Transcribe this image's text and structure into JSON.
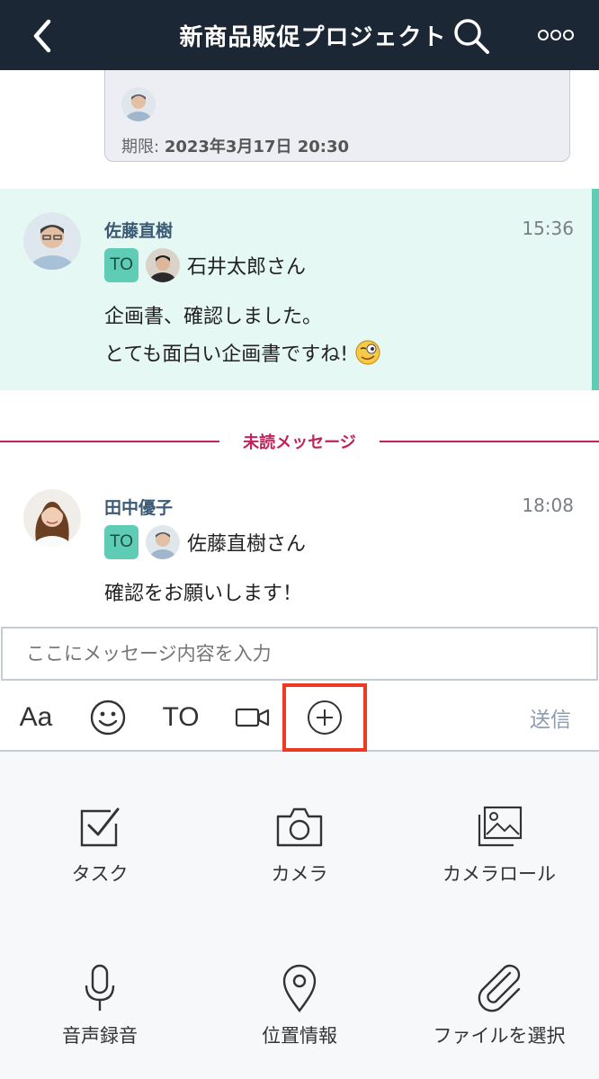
{
  "header": {
    "title": "新商品販促プロジェクト",
    "back_icon": "chevron-left-icon",
    "search_icon": "search-icon",
    "more_icon": "more-dots-icon"
  },
  "task_card": {
    "deadline_label": "期限:",
    "deadline_value": "2023年3月17日 20:30"
  },
  "messages": [
    {
      "sender": "佐藤直樹",
      "time": "15:36",
      "to_badge": "TO",
      "to_name": "石井太郎さん",
      "lines": [
        "企画書、確認しました。",
        "とても面白い企画書ですね!"
      ],
      "highlighted": true
    },
    {
      "sender": "田中優子",
      "time": "18:08",
      "to_badge": "TO",
      "to_name": "佐藤直樹さん",
      "lines": [
        "確認をお願いします！"
      ],
      "highlighted": false
    }
  ],
  "unread_label": "未読メッセージ",
  "composer": {
    "placeholder": "ここにメッセージ内容を入力",
    "font_button": "Aa",
    "to_button": "TO",
    "send_button": "送信"
  },
  "attach_menu": [
    {
      "label": "タスク",
      "icon": "task-check-icon"
    },
    {
      "label": "カメラ",
      "icon": "camera-icon"
    },
    {
      "label": "カメラロール",
      "icon": "photos-icon"
    },
    {
      "label": "音声録音",
      "icon": "microphone-icon"
    },
    {
      "label": "位置情報",
      "icon": "location-pin-icon"
    },
    {
      "label": "ファイルを選択",
      "icon": "paperclip-icon"
    }
  ],
  "colors": {
    "header_bg": "#1c2736",
    "accent": "#5fcdb6",
    "unread": "#c2215a",
    "highlight_bg": "#e5f8f3",
    "focus_outline": "#ee3a22"
  }
}
